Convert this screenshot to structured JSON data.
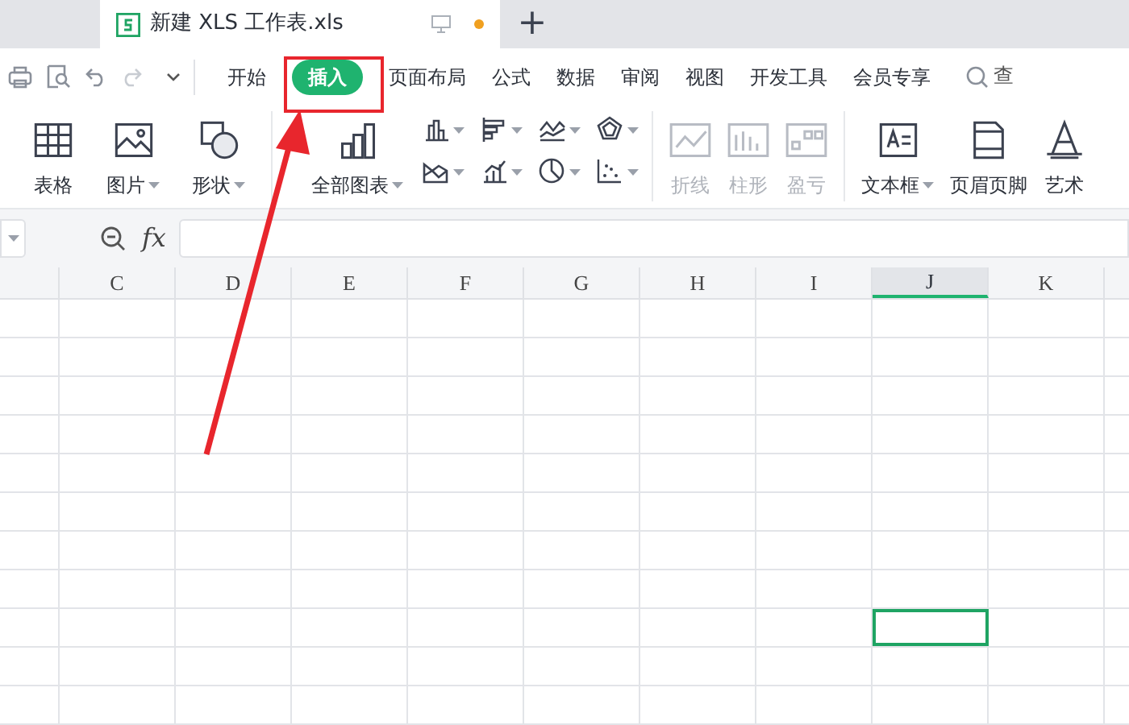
{
  "document_tab": {
    "title": "新建 XLS 工作表.xls",
    "unsaved": true
  },
  "new_tab_button": "+",
  "menu_tabs": [
    {
      "label": "开始",
      "selected": false
    },
    {
      "label": "插入",
      "selected": true
    },
    {
      "label": "页面布局",
      "selected": false
    },
    {
      "label": "公式",
      "selected": false
    },
    {
      "label": "数据",
      "selected": false
    },
    {
      "label": "审阅",
      "selected": false
    },
    {
      "label": "视图",
      "selected": false
    },
    {
      "label": "开发工具",
      "selected": false
    },
    {
      "label": "会员专享",
      "selected": false
    }
  ],
  "search": {
    "label": "查"
  },
  "ribbon_groups": [
    {
      "buttons": [
        {
          "label": "表格",
          "has_menu": false,
          "disabled": false
        },
        {
          "label": "图片",
          "has_menu": true,
          "disabled": false
        },
        {
          "label": "形状",
          "has_menu": true,
          "disabled": false
        }
      ]
    },
    {
      "buttons": [
        {
          "label": "全部图表",
          "has_menu": true,
          "disabled": false
        }
      ]
    },
    {
      "buttons": [
        {
          "label": "折线",
          "has_menu": false,
          "disabled": true
        },
        {
          "label": "柱形",
          "has_menu": false,
          "disabled": true
        },
        {
          "label": "盈亏",
          "has_menu": false,
          "disabled": true
        }
      ]
    },
    {
      "buttons": [
        {
          "label": "文本框",
          "has_menu": true,
          "disabled": false
        },
        {
          "label": "页眉页脚",
          "has_menu": false,
          "disabled": false
        },
        {
          "label": "艺术",
          "has_menu": false,
          "disabled": false
        }
      ]
    }
  ],
  "formula_bar": {
    "function_label": "fx"
  },
  "columns": [
    {
      "label": "C",
      "selected": false
    },
    {
      "label": "D",
      "selected": false
    },
    {
      "label": "E",
      "selected": false
    },
    {
      "label": "F",
      "selected": false
    },
    {
      "label": "G",
      "selected": false
    },
    {
      "label": "H",
      "selected": false
    },
    {
      "label": "I",
      "selected": false
    },
    {
      "label": "J",
      "selected": true
    },
    {
      "label": "K",
      "selected": false
    }
  ]
}
